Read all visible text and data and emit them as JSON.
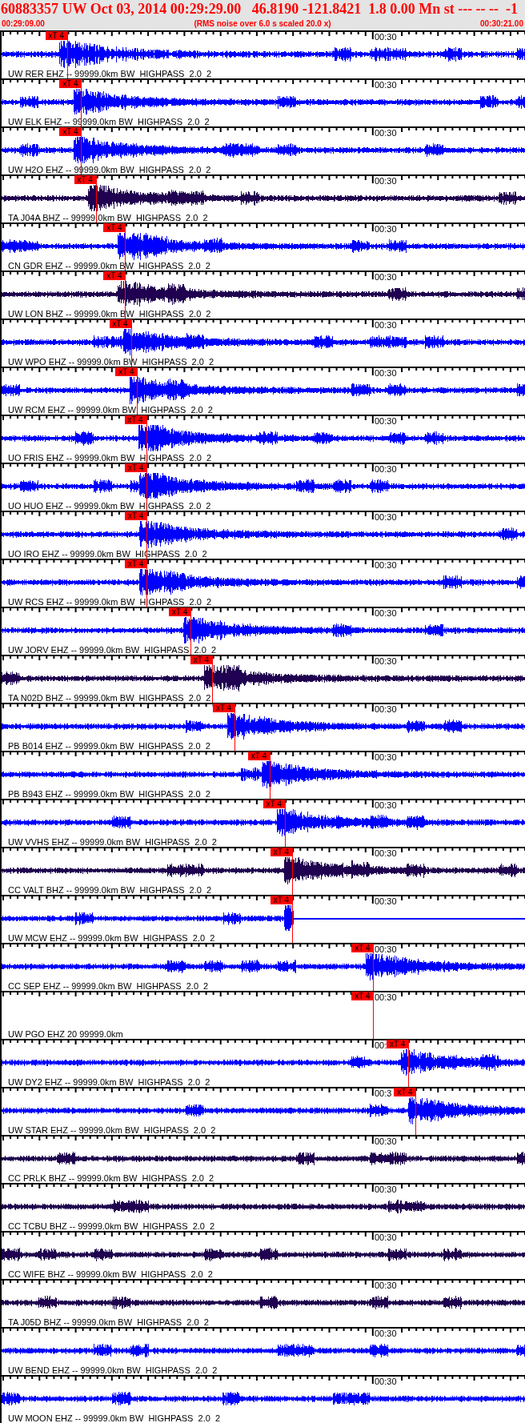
{
  "header": {
    "title": "60883357 UW Oct 03, 2014 00:29:29.00   46.8190 -121.8421  1.8 0.00 Mn st --- -- --  -1",
    "start_time": "00:29:09.00",
    "note": "(RMS noise over 6.0 s scaled 20.0 x)",
    "end_time": "00:30:21.00"
  },
  "traces": [
    {
      "label": "UW RER EHZ -- 99999.0km BW  HIGHPASS  2.0  2",
      "time_label": "00:30",
      "color": "#0000ff",
      "kind": "wave",
      "pick": {
        "text": "xT 4",
        "level": 0.125
      }
    },
    {
      "label": "UW ELK EHZ -- 99999.0km BW  HIGHPASS  2.0  2",
      "time_label": "00:30",
      "color": "#0000ff",
      "kind": "wave",
      "pick": {
        "text": "xT 4",
        "level": 0.152
      }
    },
    {
      "label": "UW H2O EHZ -- 99999.0km BW  HIGHPASS  2.0  2",
      "time_label": "00:30",
      "color": "#0000ff",
      "kind": "wave",
      "pick": {
        "text": "xT 4",
        "level": 0.152
      }
    },
    {
      "label": "TA J04A BHZ -- 99999.0km BW  HIGHPASS  2.0  2",
      "time_label": "00:30",
      "color": "#200050",
      "kind": "wave",
      "pick": {
        "text": "xT 4",
        "level": 0.18
      }
    },
    {
      "label": "CN GDR EHZ -- 99999.0km BW  HIGHPASS  2.0  2",
      "time_label": "00:30",
      "color": "#0000ff",
      "kind": "wave",
      "pick": {
        "text": "xT 4",
        "level": 0.236
      }
    },
    {
      "label": "UW LON BHZ -- 99999.0km BW  HIGHPASS  2.0  2",
      "time_label": "00:30",
      "color": "#200050",
      "kind": "wave",
      "pick": {
        "text": "xT 4",
        "level": 0.236
      }
    },
    {
      "label": "UW WPO EHZ -- 99999.0km BW  HIGHPASS  2.0  2",
      "time_label": "00:30",
      "color": "#0000ff",
      "kind": "wave",
      "pick": {
        "text": "xT 4",
        "level": 0.247
      }
    },
    {
      "label": "UW RCM EHZ -- 99999.0km BW  HIGHPASS  2.0  2",
      "time_label": "00:30",
      "color": "#0000ff",
      "kind": "wave",
      "pick": {
        "text": "xT 4",
        "level": 0.259
      }
    },
    {
      "label": "UO FRIS EHZ -- 99999.0km BW  HIGHPASS  2.0  2",
      "time_label": "00:30",
      "color": "#0000ff",
      "kind": "wave",
      "pick": {
        "text": "xT 4",
        "level": 0.276
      }
    },
    {
      "label": "UO HUO EHZ -- 99999.0km BW  HIGHPASS  2.0  2",
      "time_label": "00:30",
      "color": "#0000ff",
      "kind": "wave",
      "pick": {
        "text": "xT 4",
        "level": 0.277
      }
    },
    {
      "label": "UO IRO EHZ -- 99999.0km BW  HIGHPASS  2.0  2",
      "time_label": "00:30",
      "color": "#0000ff",
      "kind": "wave",
      "pick": {
        "text": "xT 4",
        "level": 0.277
      }
    },
    {
      "label": "UW RCS EHZ -- 99999.0km BW  HIGHPASS  2.0  2",
      "time_label": "00:30",
      "color": "#0000ff",
      "kind": "wave",
      "pick": {
        "text": "xT 4",
        "level": 0.277
      }
    },
    {
      "label": "UW JORV EHZ -- 99999.0km BW  HIGHPASS  2.0  2",
      "time_label": "00:30",
      "color": "#0000ff",
      "kind": "wave",
      "pick": {
        "text": "xT 4",
        "level": 0.361
      }
    },
    {
      "label": "TA N02D BHZ -- 99999.0km BW  HIGHPASS  2.0  2",
      "time_label": "00:30",
      "color": "#200050",
      "kind": "wave",
      "pick": {
        "text": "xT 4",
        "level": 0.402
      }
    },
    {
      "label": "PB B014 EHZ -- 99999.0km BW  HIGHPASS  2.0  2",
      "time_label": "00:30",
      "color": "#0000ff",
      "kind": "wave",
      "pick": {
        "text": "xT 4",
        "level": 0.445
      }
    },
    {
      "label": "PB B943 EHZ -- 99999.0km BW  HIGHPASS  2.0  2",
      "time_label": "00:30",
      "color": "#0000ff",
      "kind": "wave",
      "pick": {
        "text": "xT 4",
        "level": 0.512
      }
    },
    {
      "label": "UW VVHS EHZ -- 99999.0km BW  HIGHPASS  2.0  2",
      "time_label": "00:30",
      "color": "#0000ff",
      "kind": "wave",
      "pick": {
        "text": "xT 4",
        "level": 0.541
      }
    },
    {
      "label": "CC VALT BHZ -- 99999.0km BW  HIGHPASS  2.0  2",
      "time_label": "00:30",
      "color": "#200050",
      "kind": "wave",
      "pick": {
        "text": "xT 4",
        "level": 0.555
      }
    },
    {
      "label": "UW MCW EHZ -- 99999.0km BW  HIGHPASS  2.0  2",
      "time_label": "00:30",
      "color": "#0000ff",
      "kind": "dropout",
      "pick": {
        "text": "xT 4",
        "level": 0.555
      }
    },
    {
      "label": "CC SEP EHZ -- 99999.0km BW  HIGHPASS  2.0  2",
      "time_label": "00:30",
      "color": "#0000ff",
      "kind": "wave",
      "pick": {
        "text": "xT 4",
        "level": 0.71
      }
    },
    {
      "label": "UW PGO EHZ 20 99999.0km",
      "time_label": "00:30",
      "kind": "empty",
      "pick": {
        "text": "xT 4",
        "level": 0.71
      }
    },
    {
      "label": "UW DY2 EHZ -- 99999.0km BW  HIGHPASS  2.0  2",
      "time_label": "00:",
      "color": "#0000ff",
      "kind": "wave",
      "pick": {
        "text": "xT 4",
        "level": 0.777
      }
    },
    {
      "label": "UW STAR EHZ -- 99999.0km BW  HIGHPASS  2.0  2",
      "time_label": "00:3",
      "color": "#0000ff",
      "kind": "wave",
      "pick": {
        "text": "xT 4",
        "level": 0.791
      }
    },
    {
      "label": "CC PRLK BHZ -- 99999.0km BW  HIGHPASS  2.0  2",
      "time_label": "00:30",
      "color": "#200050",
      "kind": "wave"
    },
    {
      "label": "CC TCBU BHZ -- 99999.0km BW  HIGHPASS  2.0  2",
      "time_label": "00:30",
      "color": "#200050",
      "kind": "wave"
    },
    {
      "label": "CC WIFE BHZ -- 99999.0km BW  HIGHPASS  2.0  2",
      "time_label": "00:30",
      "color": "#200050",
      "kind": "wave"
    },
    {
      "label": "TA J05D BHZ -- 99999.0km BW  HIGHPASS  2.0  2",
      "time_label": "00:30",
      "color": "#200050",
      "kind": "wave"
    },
    {
      "label": "UW BEND EHZ -- 99999.0km BW  HIGHPASS  2.0  2",
      "time_label": "00:30",
      "color": "#0000ff",
      "kind": "wave"
    },
    {
      "label": "UW MOON EHZ -- 99999.0km BW  HIGHPASS  2.0  2",
      "time_label": "00:30",
      "color": "#0000ff",
      "kind": "wave"
    }
  ]
}
